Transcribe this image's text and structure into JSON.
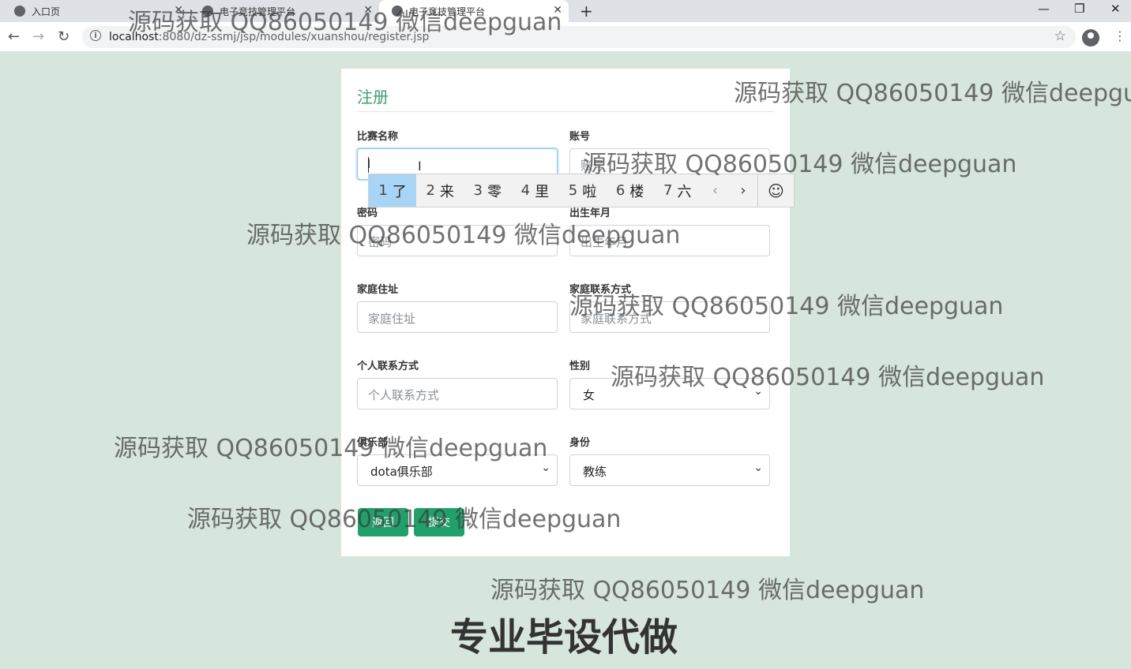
{
  "browser": {
    "tabs": [
      {
        "label": "入口页"
      },
      {
        "label": "电子竞技管理平台"
      },
      {
        "label": "电子竞技管理平台"
      }
    ],
    "url_host": "localhost",
    "url_rest": ":8080/dz-ssmj/jsp/modules/xuanshou/register.jsp"
  },
  "form": {
    "title": "注册",
    "fields": {
      "competition": {
        "label": "比赛名称",
        "value": "l"
      },
      "account": {
        "label": "账号",
        "placeholder": "账号"
      },
      "password": {
        "label": "密码",
        "placeholder": "密码"
      },
      "birth": {
        "label": "出生年月",
        "placeholder": "出生年月"
      },
      "address": {
        "label": "家庭住址",
        "placeholder": "家庭住址"
      },
      "family_contact": {
        "label": "家庭联系方式",
        "placeholder": "家庭联系方式"
      },
      "personal_contact": {
        "label": "个人联系方式",
        "placeholder": "个人联系方式"
      },
      "gender": {
        "label": "性别",
        "value": "女"
      },
      "club": {
        "label": "俱乐部",
        "value": "dota俱乐部"
      },
      "identity": {
        "label": "身份",
        "value": "教练"
      }
    },
    "back_label": "返回",
    "submit_label": "提交"
  },
  "ime": {
    "candidates": [
      {
        "n": "1",
        "c": "了"
      },
      {
        "n": "2",
        "c": "来"
      },
      {
        "n": "3",
        "c": "零"
      },
      {
        "n": "4",
        "c": "里"
      },
      {
        "n": "5",
        "c": "啦"
      },
      {
        "n": "6",
        "c": "楼"
      },
      {
        "n": "7",
        "c": "六"
      }
    ],
    "selected_index": 0,
    "prev_icon": "‹",
    "next_icon": "›",
    "emoji_icon": "☺"
  },
  "watermark": {
    "text": "源码获取 QQ86050149 微信deepguan",
    "bottom_text": "专业毕设代做"
  },
  "colors": {
    "page_bg": "#d7e6dd",
    "accent": "#3aa06b",
    "button": "#22a06b",
    "ime_selected": "#a8d4f5"
  }
}
